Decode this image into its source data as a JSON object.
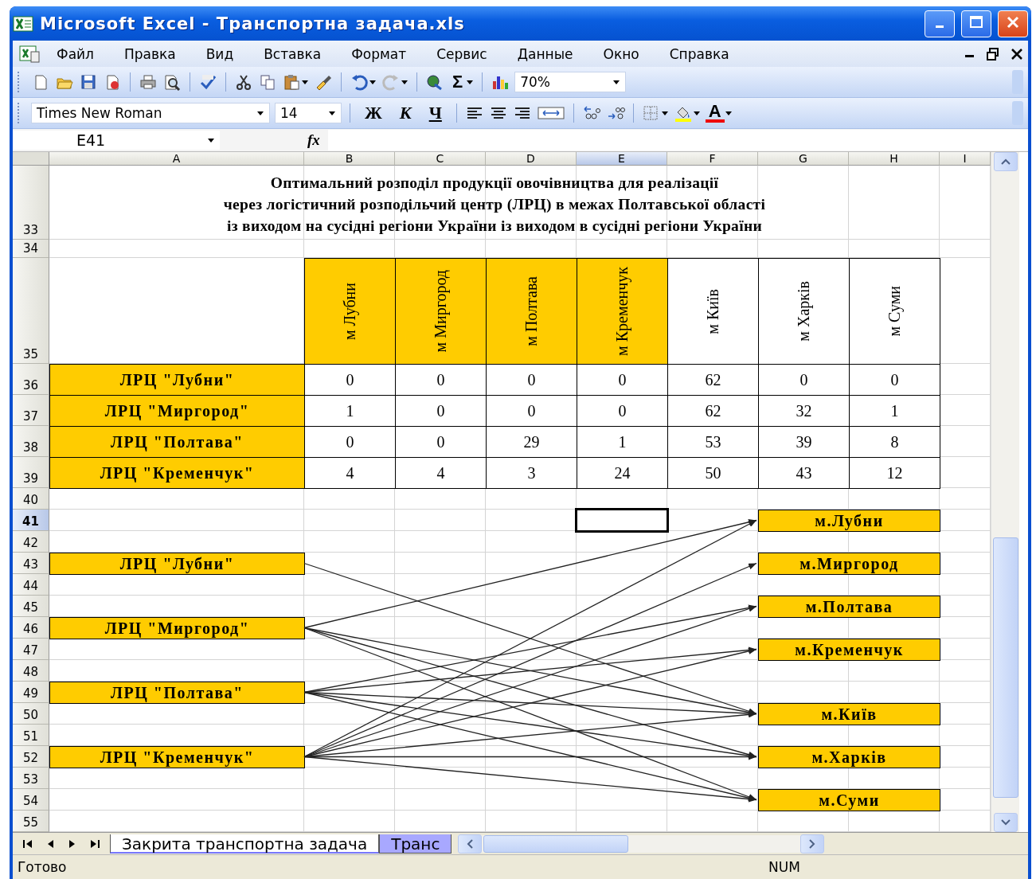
{
  "window": {
    "title": "Microsoft Excel - Транспортна задача.xls"
  },
  "menu": [
    "Файл",
    "Правка",
    "Вид",
    "Вставка",
    "Формат",
    "Сервис",
    "Данные",
    "Окно",
    "Справка"
  ],
  "toolbar": {
    "sum": "Σ",
    "zoom": "70%"
  },
  "format_bar": {
    "font": "Times New Roman",
    "size": "14",
    "styles": [
      "Ж",
      "К",
      "Ч"
    ],
    "font_color": "A"
  },
  "formula_bar": {
    "name_box": "E41",
    "fx": "fx"
  },
  "columns": [
    {
      "label": "A",
      "selected": false
    },
    {
      "label": "B",
      "selected": false
    },
    {
      "label": "C",
      "selected": false
    },
    {
      "label": "D",
      "selected": false
    },
    {
      "label": "E",
      "selected": true
    },
    {
      "label": "F",
      "selected": false
    },
    {
      "label": "G",
      "selected": false
    },
    {
      "label": "H",
      "selected": false
    },
    {
      "label": "I",
      "selected": false
    }
  ],
  "rows": [
    {
      "label": "33",
      "selected": false
    },
    {
      "label": "34",
      "selected": false
    },
    {
      "label": "35",
      "selected": false
    },
    {
      "label": "36",
      "selected": false
    },
    {
      "label": "37",
      "selected": false
    },
    {
      "label": "38",
      "selected": false
    },
    {
      "label": "39",
      "selected": false
    },
    {
      "label": "40",
      "selected": false
    },
    {
      "label": "41",
      "selected": true
    },
    {
      "label": "42",
      "selected": false
    },
    {
      "label": "43",
      "selected": false
    },
    {
      "label": "44",
      "selected": false
    },
    {
      "label": "45",
      "selected": false
    },
    {
      "label": "46",
      "selected": false
    },
    {
      "label": "47",
      "selected": false
    },
    {
      "label": "48",
      "selected": false
    },
    {
      "label": "49",
      "selected": false
    },
    {
      "label": "50",
      "selected": false
    },
    {
      "label": "51",
      "selected": false
    },
    {
      "label": "52",
      "selected": false
    },
    {
      "label": "53",
      "selected": false
    },
    {
      "label": "54",
      "selected": false
    },
    {
      "label": "55",
      "selected": false
    }
  ],
  "title": [
    "Оптимальний розподіл продукції овочівництва для реалізації",
    "через логістичний розподільчий центр (ЛРЦ) в межах Полтавської області",
    "із виходом на сусідні регіони України із виходом в сусідні регіони України"
  ],
  "table": {
    "headers": [
      {
        "label": "м Лубни",
        "highlighted": true
      },
      {
        "label": "м Миргород",
        "highlighted": true
      },
      {
        "label": "м Полтава",
        "highlighted": true
      },
      {
        "label": "м Кременчук",
        "highlighted": true
      },
      {
        "label": "м Київ",
        "highlighted": false
      },
      {
        "label": "м Харків",
        "highlighted": false
      },
      {
        "label": "м Суми",
        "highlighted": false
      }
    ],
    "rows": [
      {
        "label": "ЛРЦ \"Лубни\"",
        "values": [
          "0",
          "0",
          "0",
          "0",
          "62",
          "0",
          "0"
        ]
      },
      {
        "label": "ЛРЦ \"Миргород\"",
        "values": [
          "1",
          "0",
          "0",
          "0",
          "62",
          "32",
          "1"
        ]
      },
      {
        "label": "ЛРЦ \"Полтава\"",
        "values": [
          "0",
          "0",
          "29",
          "1",
          "53",
          "39",
          "8"
        ]
      },
      {
        "label": "ЛРЦ \"Кременчук\"",
        "values": [
          "4",
          "4",
          "3",
          "24",
          "50",
          "43",
          "12"
        ]
      }
    ]
  },
  "sources": [
    "ЛРЦ \"Лубни\"",
    "ЛРЦ \"Миргород\"",
    "ЛРЦ \"Полтава\"",
    "ЛРЦ \"Кременчук\""
  ],
  "destinations": [
    "м.Лубни",
    "м.Миргород",
    "м.Полтава",
    "м.Кременчук",
    "м.Київ",
    "м.Харків",
    "м.Суми"
  ],
  "sheet_tabs": [
    {
      "label": "Закрита транспортна задача",
      "selected": true
    },
    {
      "label": "Транс",
      "selected": false
    }
  ],
  "status": {
    "text": "Готово",
    "indicator": "NUM"
  }
}
